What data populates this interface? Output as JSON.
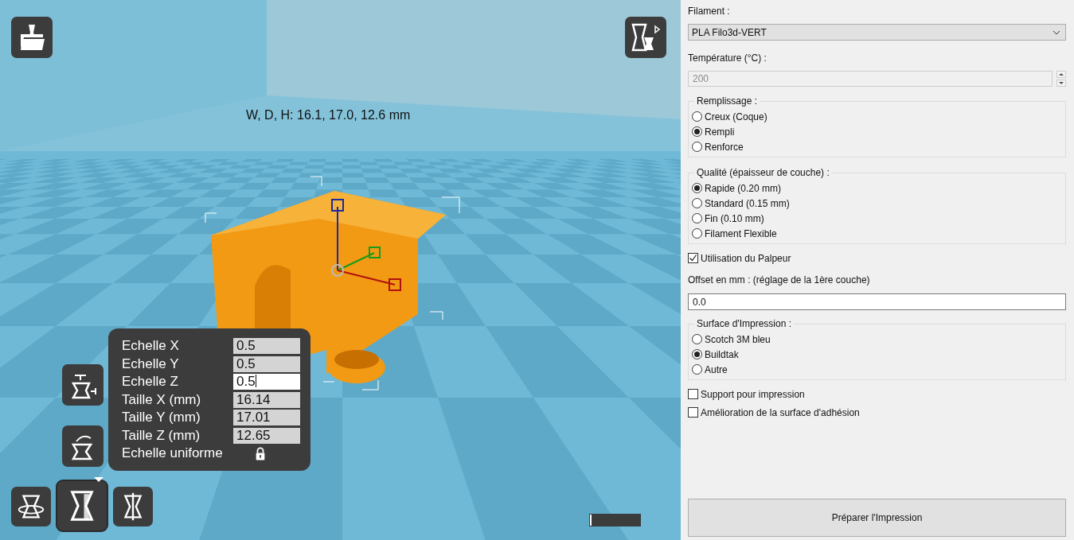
{
  "viewport": {
    "dimensions": "W, D, H: 16.1, 17.0, 12.6 mm",
    "progress": {
      "level": 0.03
    },
    "tools": [
      {
        "kind": "load",
        "selected": false
      },
      {
        "kind": "view",
        "selected": false
      },
      {
        "kind": "lay_flat",
        "selected": false
      },
      {
        "kind": "reset",
        "selected": false
      },
      {
        "kind": "rotate",
        "selected": false
      },
      {
        "kind": "scale",
        "selected": true
      },
      {
        "kind": "mirror",
        "selected": false
      }
    ]
  },
  "scale_panel": {
    "rows": [
      {
        "label": "Echelle X",
        "value": "0.5",
        "focused": false
      },
      {
        "label": "Echelle Y",
        "value": "0.5",
        "focused": false
      },
      {
        "label": "Echelle Z",
        "value": "0.5",
        "focused": true
      },
      {
        "label": "Taille X (mm)",
        "value": "16.14",
        "focused": false
      },
      {
        "label": "Taille Y (mm)",
        "value": "17.01",
        "focused": false
      },
      {
        "label": "Taille Z (mm)",
        "value": "12.65",
        "focused": false
      }
    ],
    "uniform": {
      "label": "Echelle uniforme",
      "locked": true
    }
  },
  "settings": {
    "fields": [
      {
        "kind": "dropdown",
        "label": "Filament :",
        "value": "PLA Filo3d-VERT"
      },
      {
        "kind": "spinbox",
        "label": "Température (°C) :",
        "value": "200",
        "disabled": true
      },
      {
        "kind": "radio_group",
        "label": "Remplissage :",
        "options": [
          {
            "label": "Creux (Coque)",
            "selected": false
          },
          {
            "label": "Rempli",
            "selected": true
          },
          {
            "label": "Renforce",
            "selected": false
          }
        ]
      },
      {
        "kind": "radio_group",
        "label": "Qualité (épaisseur de couche) :",
        "options": [
          {
            "label": "Rapide (0.20 mm)",
            "selected": true
          },
          {
            "label": "Standard (0.15 mm)",
            "selected": false
          },
          {
            "label": "Fin (0.10 mm)",
            "selected": false
          },
          {
            "label": "Filament Flexible",
            "selected": false
          }
        ]
      },
      {
        "kind": "checkbox",
        "label": "Utilisation du Palpeur",
        "checked": true
      },
      {
        "kind": "text_field",
        "label": "Offset en mm : (réglage de la 1ère couche)",
        "value": "0.0"
      },
      {
        "kind": "radio_group",
        "label": "Surface d'Impression :",
        "options": [
          {
            "label": "Scotch 3M bleu",
            "selected": false
          },
          {
            "label": "Buildtak",
            "selected": true
          },
          {
            "label": "Autre",
            "selected": false
          }
        ]
      },
      {
        "kind": "checkbox",
        "label": "Support pour impression",
        "checked": false
      },
      {
        "kind": "checkbox",
        "label": "Amélioration de la surface d'adhésion",
        "checked": false
      }
    ],
    "button": "Préparer l'Impression"
  }
}
